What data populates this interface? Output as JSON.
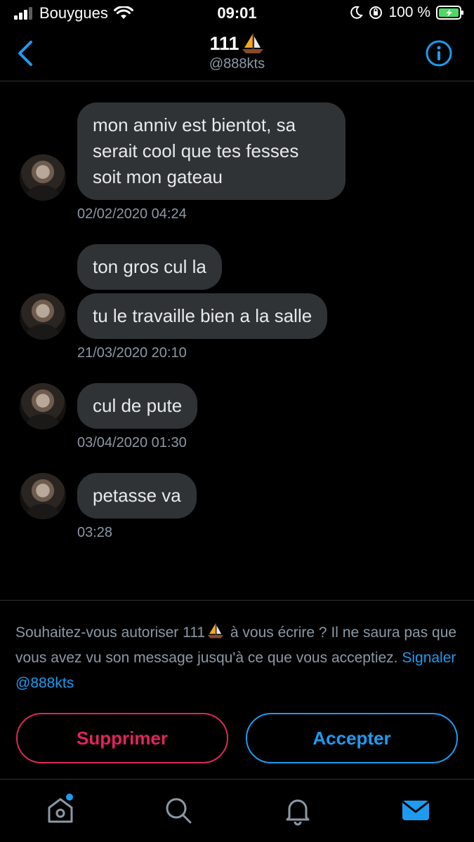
{
  "status_bar": {
    "carrier": "Bouygues",
    "time": "09:01",
    "battery": "100 %",
    "icons": [
      "signal-icon",
      "wifi-icon",
      "moon-icon",
      "orientation-lock-icon",
      "battery-charging-icon"
    ]
  },
  "header": {
    "name": "111",
    "handle": "@888kts",
    "back_icon": "chevron-left-icon",
    "info_icon": "info-icon"
  },
  "messages": [
    {
      "lines": [
        "mon anniv est bientot, sa",
        "serait cool que tes fesses",
        "soit mon gateau"
      ],
      "timestamp": "02/02/2020 04:24"
    },
    {
      "bubbles": [
        "ton gros cul la",
        "tu le travaille bien a la salle"
      ],
      "timestamp": "21/03/2020 20:10"
    },
    {
      "bubbles": [
        "cul de pute"
      ],
      "timestamp": "03/04/2020 01:30"
    },
    {
      "bubbles": [
        "petasse va"
      ],
      "timestamp": "03:28"
    }
  ],
  "request": {
    "text_before": "Souhaitez-vous autoriser 111",
    "text_after": " à vous écrire ? Il ne saura pas que vous avez vu son message jusqu'à ce que vous acceptiez.",
    "report_link": "Signaler @888kts",
    "delete_label": "Supprimer",
    "accept_label": "Accepter"
  },
  "tab_bar": {
    "tabs": [
      "home-icon",
      "search-icon",
      "bell-icon",
      "mail-icon"
    ],
    "active": "mail-icon"
  },
  "colors": {
    "background": "#000000",
    "bubble": "#2f3336",
    "accent": "#1d9bf0",
    "danger": "#e0245e",
    "muted": "#8b98a5"
  }
}
